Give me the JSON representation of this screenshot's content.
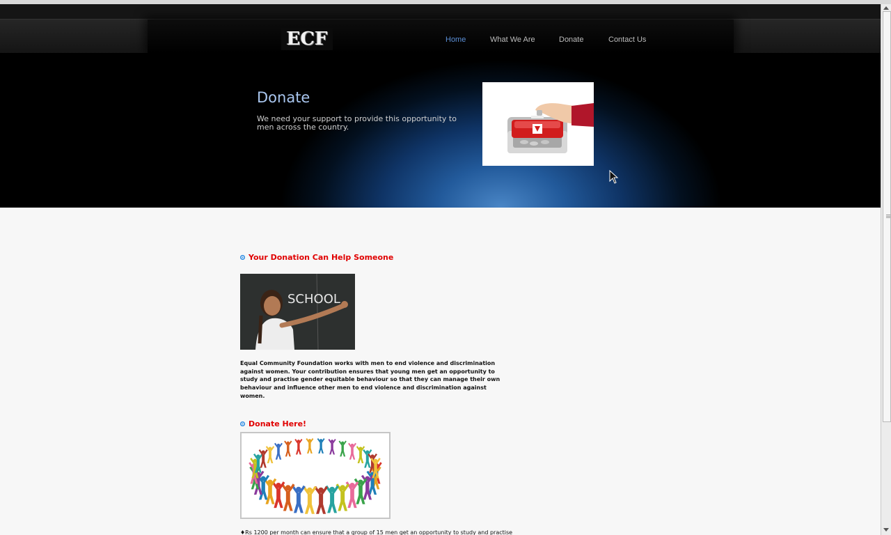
{
  "logo": {
    "text": "ECF"
  },
  "nav": {
    "items": [
      {
        "label": "Home",
        "active": true
      },
      {
        "label": "What We Are",
        "active": false
      },
      {
        "label": "Donate",
        "active": false
      },
      {
        "label": "Contact Us",
        "active": false
      }
    ]
  },
  "hero": {
    "title": "Donate",
    "text": "We need your support to provide this opportunity to men across the country.",
    "image": "donation-box-icon"
  },
  "section1": {
    "heading": "Your Donation Can Help Someone",
    "image_text": "SCHOOL",
    "body": "Equal Community Foundation works with men to end violence and discrimination against women. Your contribution ensures that young men get an opportunity to study and practise gender equitable behaviour so that they can manage their own behaviour and influence other men to end violence and discrimination against women."
  },
  "section2": {
    "heading": "Donate Here!",
    "image": "people-circle-icon",
    "body": "♦Rs 1200 per month can ensure that a group of 15 men get an opportunity to study and practise"
  },
  "colors": {
    "accent_blue": "#5b8fd6",
    "heading_red": "#e00000",
    "bullet_blue": "#2f8be0"
  }
}
